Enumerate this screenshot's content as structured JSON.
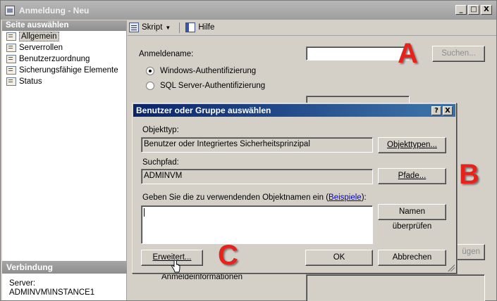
{
  "window": {
    "title": "Anmeldung - Neu",
    "controls": [
      "_",
      "□",
      "X"
    ]
  },
  "left_pane": {
    "header": "Seite auswählen",
    "items": [
      {
        "label": "Allgemein",
        "selected": true
      },
      {
        "label": "Serverrollen"
      },
      {
        "label": "Benutzerzuordnung"
      },
      {
        "label": "Sicherungsfähige Elemente"
      },
      {
        "label": "Status"
      }
    ],
    "connection_header": "Verbindung",
    "server_label": "Server:",
    "server_value": "ADMINVM\\INSTANCE1"
  },
  "toolbar": {
    "script_label": "Skript",
    "help_label": "Hilfe"
  },
  "login": {
    "name_label": "Anmeldename:",
    "name_value": "",
    "search_button": "Suchen...",
    "windows_auth": "Windows-Authentifizierung",
    "sql_auth": "SQL Server-Authentifizierung",
    "partial_button": "ügen",
    "partial_text": "Anmeldeinformationen"
  },
  "annotations": {
    "a": "A",
    "b": "B",
    "c": "C"
  },
  "dialog": {
    "title": "Benutzer oder Gruppe auswählen",
    "help_btn": "?",
    "close_btn": "X",
    "object_type_label": "Objekttyp:",
    "object_type_value": "Benutzer oder Integriertes Sicherheitsprinzipal",
    "object_types_button": "Objekttypen...",
    "location_label": "Suchpfad:",
    "location_value": "ADMINVM",
    "paths_button": "Pfade...",
    "names_label_prefix": "Geben Sie die zu verwendenden Objektnamen ein (",
    "examples_link": "Beispiele",
    "names_label_suffix": "):",
    "names_value": "",
    "check_names_button": "Namen überprüfen",
    "advanced_button": "Erweitert...",
    "ok_button": "OK",
    "cancel_button": "Abbrechen"
  }
}
